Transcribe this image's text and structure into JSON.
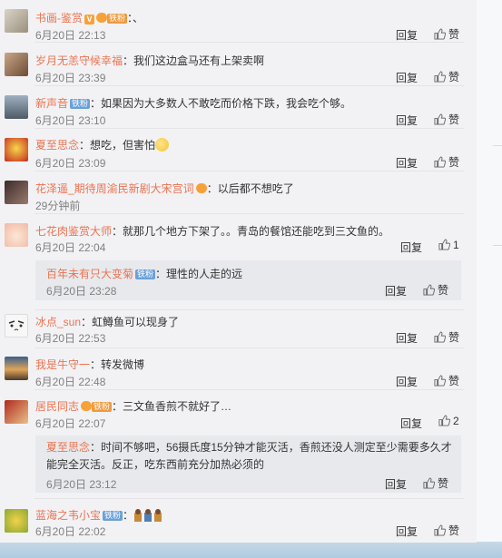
{
  "actions": {
    "reply": "回复",
    "like": "赞"
  },
  "comments": [
    {
      "user": "书画-鉴赏",
      "badge_fan": "铁粉",
      "text": "：、",
      "time": "6月20日 22:13",
      "likes": ""
    },
    {
      "user": "岁月无恙守候幸福",
      "text": "：我们这边盒马还有上架卖啊",
      "time": "6月20日 23:39",
      "likes": ""
    },
    {
      "user": "新声音",
      "badge": "铁粉",
      "text": "：如果因为大多数人不敢吃而价格下跌，我会吃个够。",
      "time": "6月20日 23:10",
      "likes": ""
    },
    {
      "user": "夏至思念",
      "text": "：想吃，但害怕",
      "time": "6月20日 23:09",
      "likes": ""
    },
    {
      "user": "花泽遥_期待周渝民新剧大宋宫词",
      "text": "：以后都不想吃了",
      "time": "29分钟前",
      "likes": ""
    },
    {
      "user": "七花肉鉴赏大师",
      "text": "：就那几个地方下架了。。青岛的餐馆还能吃到三文鱼的。",
      "time": "6月20日 22:04",
      "likes": "1",
      "sub": {
        "user": "百年未有只大变菊",
        "badge": "铁粉",
        "text": "：理性的人走的远",
        "time": "6月20日 23:28"
      }
    },
    {
      "user": "冰点_sun",
      "text": "：虹鳟鱼可以现身了",
      "time": "6月20日 22:53",
      "likes": ""
    },
    {
      "user": "我是牛守一",
      "text": "：转发微博",
      "time": "6月20日 22:48",
      "likes": ""
    },
    {
      "user": "居民同志",
      "badge_fan": "铁粉",
      "text": "：三文鱼香煎不就好了…",
      "time": "6月20日 22:07",
      "likes": "2",
      "sub": {
        "user": "夏至思念",
        "text": "：时间不够吧，56摄氏度15分钟才能灭活，香煎还没人测定至少需要多久才能完全灭活。反正，吃东西前充分加热必须的",
        "time": "6月20日 23:12"
      }
    },
    {
      "user": "蓝海之韦小宝",
      "badge": "铁粉",
      "text": "：",
      "time": "6月20日 22:02",
      "likes": ""
    }
  ],
  "colors": {
    "username": "#eb7350",
    "timestamp": "#808080",
    "text": "#333333"
  }
}
